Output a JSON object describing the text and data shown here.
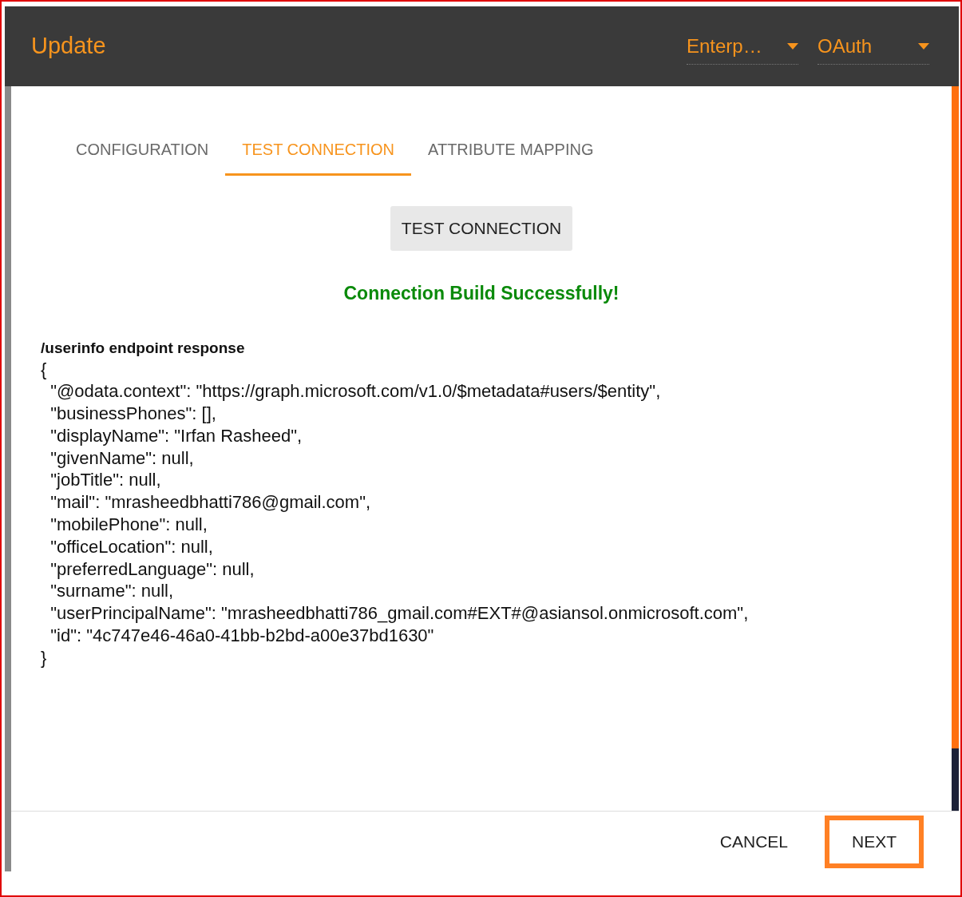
{
  "header": {
    "title": "Update",
    "dropdowns": [
      {
        "value": "Enterp…"
      },
      {
        "value": "OAuth"
      }
    ]
  },
  "tabs": [
    {
      "label": "CONFIGURATION",
      "selected": false
    },
    {
      "label": "TEST CONNECTION",
      "selected": true
    },
    {
      "label": "ATTRIBUTE MAPPING",
      "selected": false
    }
  ],
  "test_button": "TEST CONNECTION",
  "status_message": "Connection Build Successfully!",
  "response": {
    "heading": "/userinfo endpoint response",
    "lines": [
      "{",
      "  \"@odata.context\": \"https://graph.microsoft.com/v1.0/$metadata#users/$entity\",",
      "  \"businessPhones\": [],",
      "  \"displayName\": \"Irfan Rasheed\",",
      "  \"givenName\": null,",
      "  \"jobTitle\": null,",
      "  \"mail\": \"mrasheedbhatti786@gmail.com\",",
      "  \"mobilePhone\": null,",
      "  \"officeLocation\": null,",
      "  \"preferredLanguage\": null,",
      "  \"surname\": null,",
      "  \"userPrincipalName\": \"mrasheedbhatti786_gmail.com#EXT#@asiansol.onmicrosoft.com\",",
      "  \"id\": \"4c747e46-46a0-41bb-b2bd-a00e37bd1630\"",
      "}"
    ]
  },
  "footer": {
    "buttons": [
      {
        "label": "CANCEL",
        "highlighted": false
      },
      {
        "label": "NEXT",
        "highlighted": true
      }
    ]
  }
}
